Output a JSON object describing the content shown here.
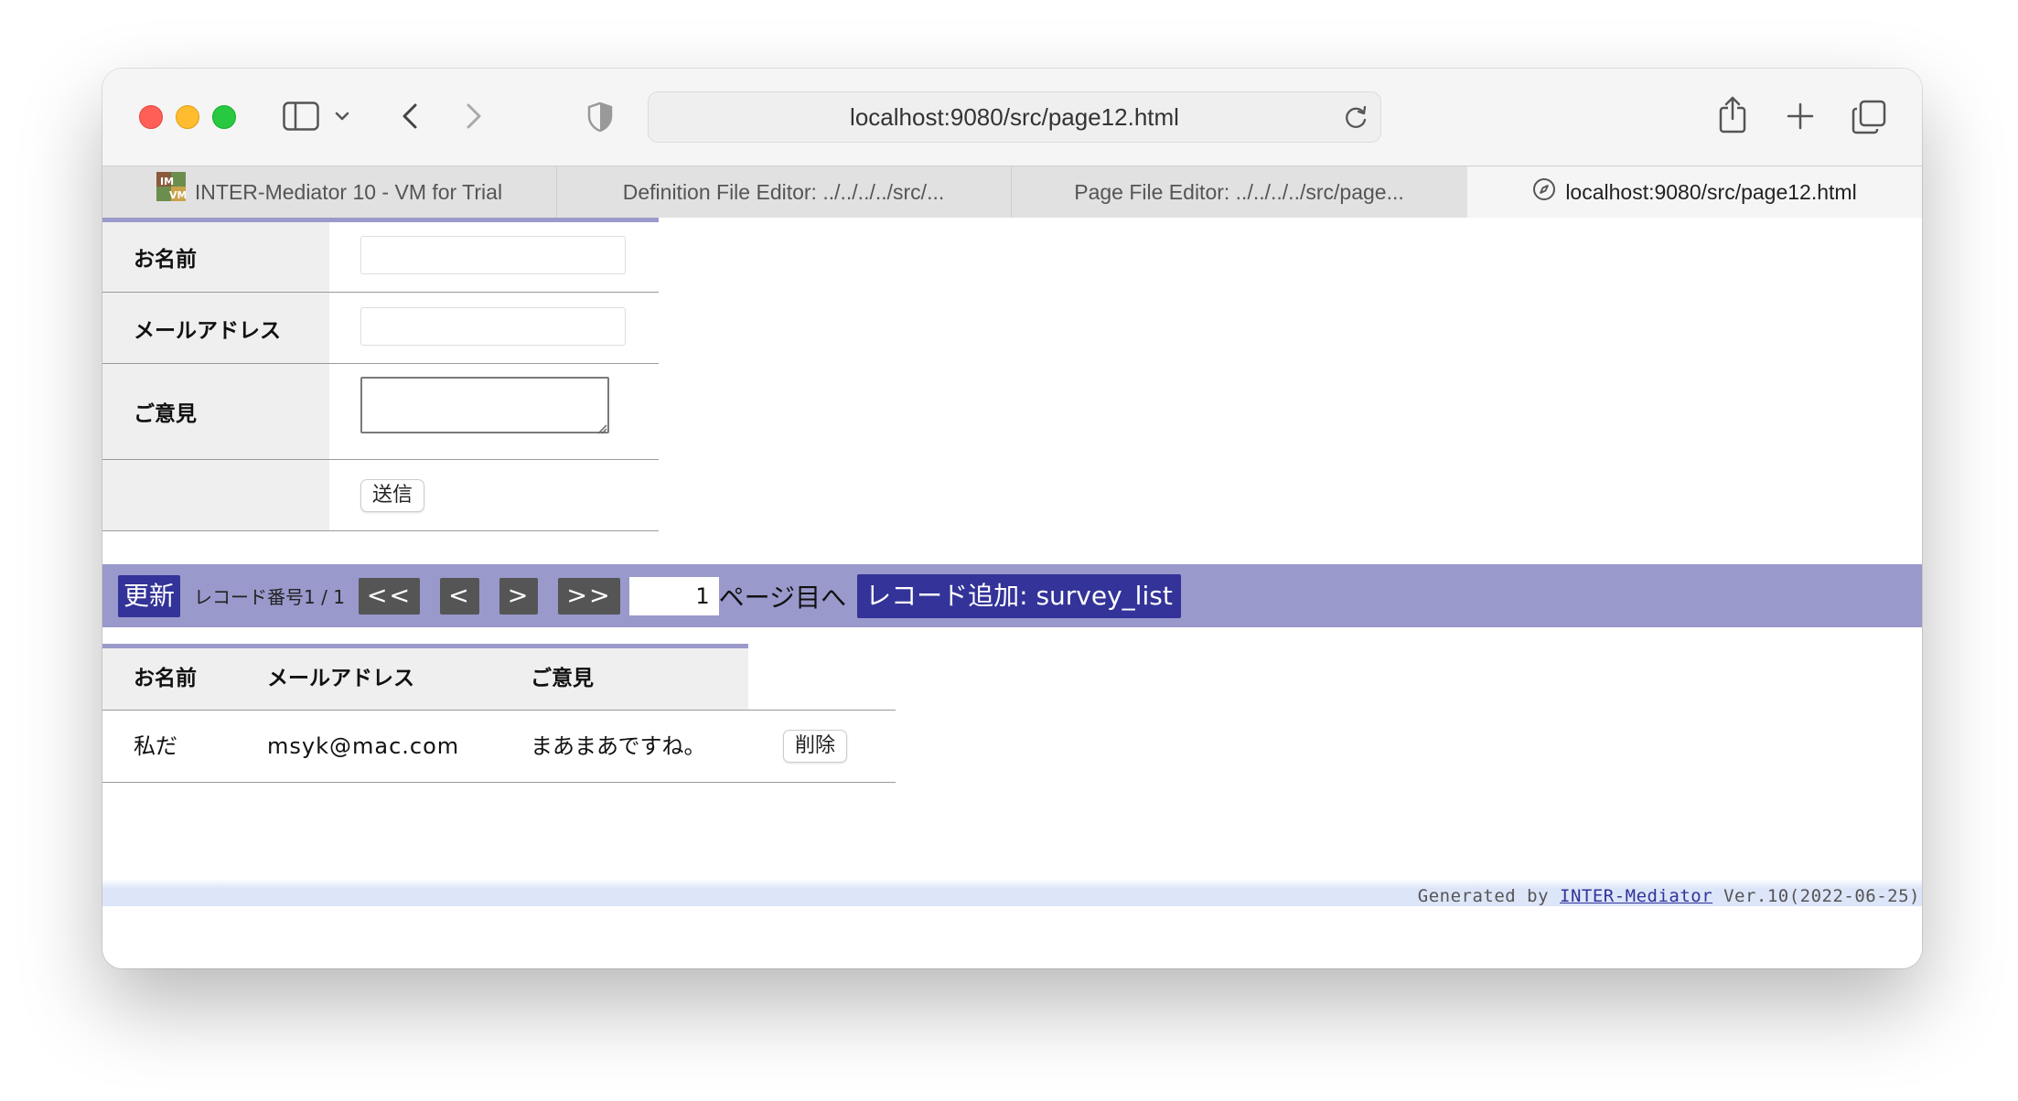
{
  "browser": {
    "url": "localhost:9080/src/page12.html",
    "tabs": [
      {
        "label": "INTER-Mediator 10 - VM for Trial",
        "active": false
      },
      {
        "label": "Definition File Editor: ../../../../src/...",
        "active": false
      },
      {
        "label": "Page File Editor: ../../../../src/page...",
        "active": false
      },
      {
        "label": "localhost:9080/src/page12.html",
        "active": true
      }
    ]
  },
  "form": {
    "name_label": "お名前",
    "email_label": "メールアドレス",
    "opinion_label": "ご意見",
    "name_value": "",
    "email_value": "",
    "opinion_value": "",
    "submit_label": "送信"
  },
  "navigation": {
    "refresh_label": "更新",
    "record_info": "レコード番号1 / 1",
    "first_label": "<<",
    "prev_label": "<",
    "next_label": ">",
    "last_label": ">>",
    "page_value": "1",
    "page_suffix": "ページ目へ",
    "add_record_label": "レコード追加: survey_list"
  },
  "list": {
    "headers": [
      "お名前",
      "メールアドレス",
      "ご意見"
    ],
    "rows": [
      {
        "name": "私だ",
        "email": "msyk@mac.com",
        "opinion": "まあまあですね。",
        "delete_label": "削除"
      }
    ]
  },
  "footer": {
    "prefix": "Generated by ",
    "link": "INTER-Mediator",
    "suffix": " Ver.10(2022-06-25)"
  },
  "colors": {
    "nav_bar": "#9999cc",
    "nav_button_dark": "#333399",
    "nav_move_button": "#555555",
    "table_header_bg": "#efefef",
    "table_top_border": "#9a9acb",
    "footer_bg": "#dde5f9"
  }
}
